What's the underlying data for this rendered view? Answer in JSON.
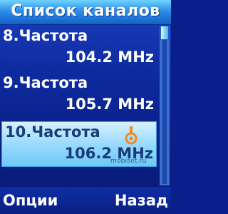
{
  "header": {
    "title": "Список каналов"
  },
  "channels": [
    {
      "name": "8.Частота",
      "frequency": "104.2 MHz"
    },
    {
      "name": "9.Частота",
      "frequency": "105.7 MHz"
    },
    {
      "name": "10.Частота",
      "frequency": "106.2 MHz",
      "selected": true
    }
  ],
  "selected_index": 2,
  "selected_icon": "radio-icon",
  "watermark": "mobiset.ru",
  "softkeys": {
    "left": "Опции",
    "right": "Назад"
  },
  "colors": {
    "background": "#0e2a9e",
    "header": "#2e8ee8",
    "selection": "#9fdcff",
    "selected_text": "#163c7a",
    "icon_accent": "#f08a1c"
  }
}
